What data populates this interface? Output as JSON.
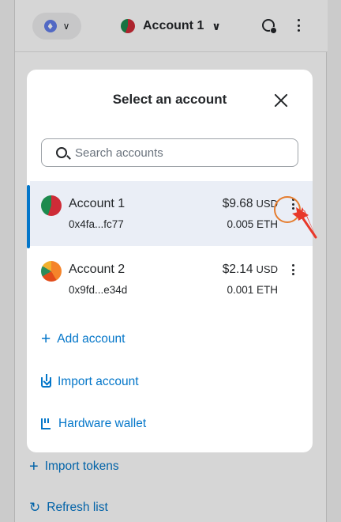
{
  "header": {
    "network_icon": "ethereum-icon",
    "account_label": "Account 1",
    "globe_icon": "globe-icon",
    "menu_icon": "kebab-icon"
  },
  "background": {
    "import_tokens": "Import tokens",
    "refresh_list": "Refresh list"
  },
  "modal": {
    "title": "Select an account",
    "search_placeholder": "Search accounts",
    "accounts": [
      {
        "name": "Account 1",
        "address": "0x4fa...fc77",
        "fiat": "$9.68",
        "currency": "USD",
        "eth": "0.005 ETH",
        "selected": true
      },
      {
        "name": "Account 2",
        "address": "0x9fd...e34d",
        "fiat": "$2.14",
        "currency": "USD",
        "eth": "0.001 ETH",
        "selected": false
      }
    ],
    "actions": {
      "add_account": "Add account",
      "import_account": "Import account",
      "hardware_wallet": "Hardware wallet"
    }
  },
  "colors": {
    "accent": "#0376c9",
    "highlight": "#e57d2f",
    "arrow": "#e8382a"
  }
}
